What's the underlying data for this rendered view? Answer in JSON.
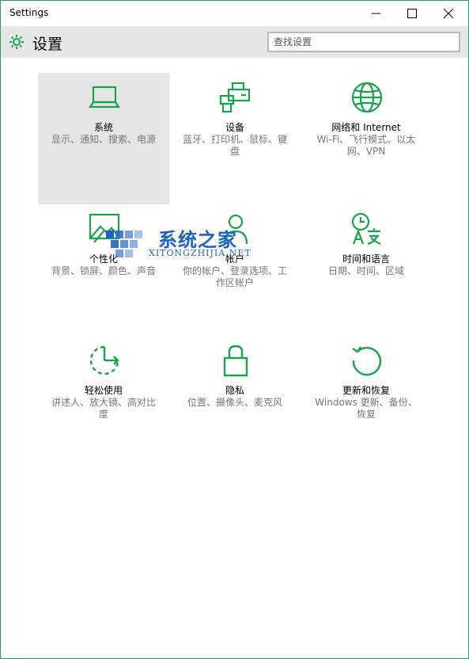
{
  "window": {
    "title": "Settings"
  },
  "header": {
    "title": "设置",
    "search_placeholder": "查找设置"
  },
  "colors": {
    "accent": "#1db954",
    "icon_green": "#17a34a",
    "selected_bg": "#e5e5e5",
    "header_bg": "#e6e6e6"
  },
  "tiles": [
    {
      "name": "系统",
      "desc": "显示、通知、搜索、电源",
      "icon": "laptop-icon",
      "selected": true
    },
    {
      "name": "设备",
      "desc": "蓝牙、打印机、鼠标、键盘",
      "icon": "devices-icon"
    },
    {
      "name": "网络和 Internet",
      "desc": "Wi-Fi、飞行模式、以太网、VPN",
      "icon": "globe-icon"
    },
    {
      "name": "个性化",
      "desc": "背景、锁屏、颜色、声音",
      "icon": "personalization-icon"
    },
    {
      "name": "帐户",
      "desc": "你的帐户、登录选项、工作区帐户",
      "icon": "person-icon"
    },
    {
      "name": "时间和语言",
      "desc": "日期、时间、区域",
      "icon": "time-language-icon"
    },
    {
      "name": "轻松使用",
      "desc": "讲述人、放大镜、高对比度",
      "icon": "ease-of-access-icon"
    },
    {
      "name": "隐私",
      "desc": "位置、摄像头、麦克风",
      "icon": "lock-icon"
    },
    {
      "name": "更新和恢复",
      "desc": "Windows 更新、备份、恢复",
      "icon": "update-icon"
    }
  ],
  "watermark": {
    "title": "系统之家",
    "subtitle": "XITONGZHIJIA.NET"
  }
}
